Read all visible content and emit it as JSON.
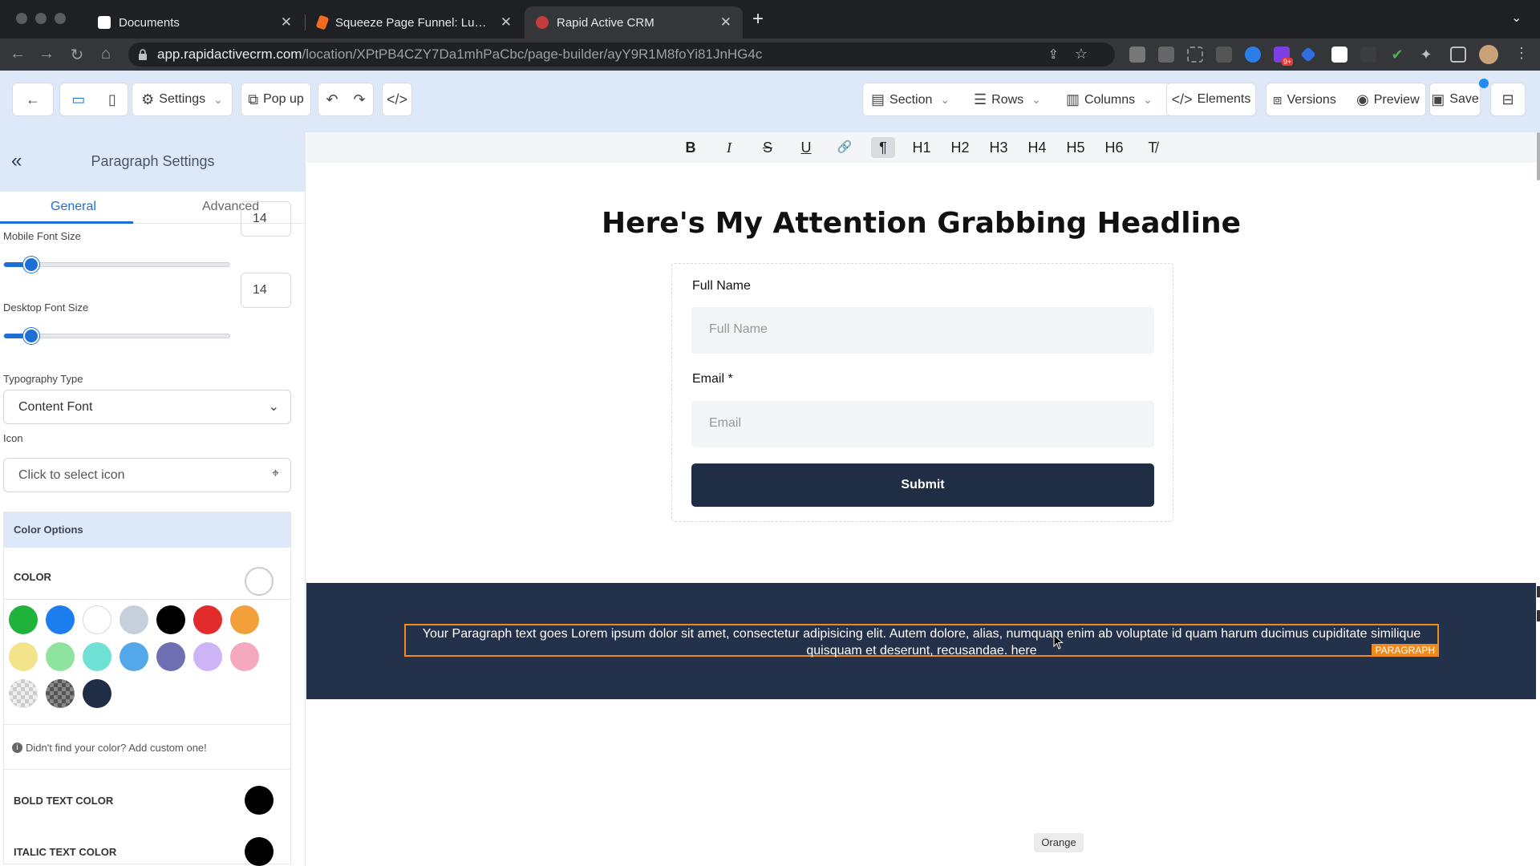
{
  "browser": {
    "tabs": [
      {
        "title": "Documents"
      },
      {
        "title": "Squeeze Page Funnel: Lucidch"
      },
      {
        "title": "Rapid Active CRM"
      }
    ],
    "new_tab": "+",
    "url_host": "app.rapidactivecrm.com",
    "url_path": "/location/XPtPB4CZY7Da1mhPaCbc/page-builder/ayY9R1M8foYi81JnHG4c",
    "extension_badge": "9+"
  },
  "toolbar": {
    "settings": "Settings",
    "popup": "Pop up",
    "section": "Section",
    "rows": "Rows",
    "columns": "Columns",
    "elements": "Elements",
    "versions": "Versions",
    "preview": "Preview",
    "save": "Save"
  },
  "panel": {
    "title": "Paragraph Settings",
    "tabs": [
      "General",
      "Advanced"
    ],
    "mobile_font_size_label": "Mobile Font Size",
    "mobile_font_size": "14",
    "desktop_font_size_label": "Desktop Font Size",
    "desktop_font_size": "14",
    "slider_fraction": 0.125,
    "typography_label": "Typography Type",
    "typography_value": "Content Font",
    "icon_label": "Icon",
    "icon_placeholder": "Click to select icon",
    "color_options_title": "Color Options",
    "color_label": "COLOR",
    "swatches": [
      "#1fb33b",
      "#1d7ef0",
      "#ffffff",
      "#c5d0da",
      "#000000",
      "#e22b2b",
      "#f3a03b",
      "#f3e38a",
      "#8ee39e",
      "#6fe0d3",
      "#54a7e8",
      "#6f6fb3",
      "#cdb4f7",
      "#f5a9bf",
      "transparent",
      "transparent-dark",
      "#1f2e45"
    ],
    "custom_hint": "Didn't find your color? Add custom one!",
    "bold_text_color_label": "BOLD TEXT COLOR",
    "italic_text_color_label": "ITALIC TEXT COLOR"
  },
  "format_bar": {
    "bold": "B",
    "italic": "I",
    "strike": "S",
    "underline": "U",
    "link": "🔗",
    "paragraph": "¶",
    "headings": [
      "H1",
      "H2",
      "H3",
      "H4",
      "H5",
      "H6"
    ],
    "clear": "T̸"
  },
  "page": {
    "headline": "Here's My Attention Grabbing Headline",
    "form": {
      "full_name_label": "Full Name",
      "full_name_placeholder": "Full Name",
      "email_label": "Email *",
      "email_placeholder": "Email",
      "submit": "Submit"
    },
    "paragraph_text": "Your Paragraph text goes Lorem ipsum dolor sit amet, consectetur adipisicing elit. Autem dolore, alias, numquam enim ab voluptate id quam harum ducimus cupiditate similique quisquam et deserunt, recusandae. here",
    "paragraph_tag": "PARAGRAPH",
    "tooltip": "Orange"
  },
  "colors": {
    "accent": "#1d6fd6",
    "dark_navy": "#1f2e45",
    "selection_orange": "#f08a1c"
  }
}
